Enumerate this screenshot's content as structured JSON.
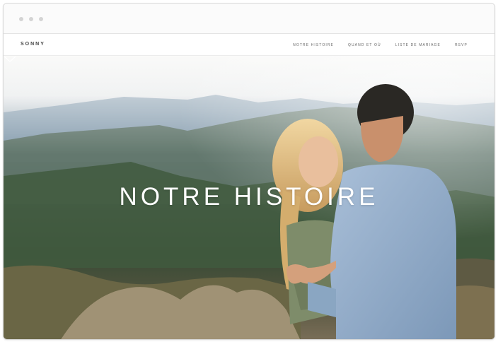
{
  "browser": {
    "dots": [
      "dot-1",
      "dot-2",
      "dot-3"
    ]
  },
  "nav": {
    "brand": "SONNY",
    "links": [
      "NOTRE HISTOIRE",
      "QUAND ET OÙ",
      "LISTE DE MARIAGE",
      "RSVP"
    ]
  },
  "hero": {
    "title": "NOTRE HISTOIRE",
    "scroll_icon": "chevron-down-icon"
  },
  "colors": {
    "text_white": "#ffffff",
    "nav_text": "#666666",
    "brand_text": "#444444"
  }
}
